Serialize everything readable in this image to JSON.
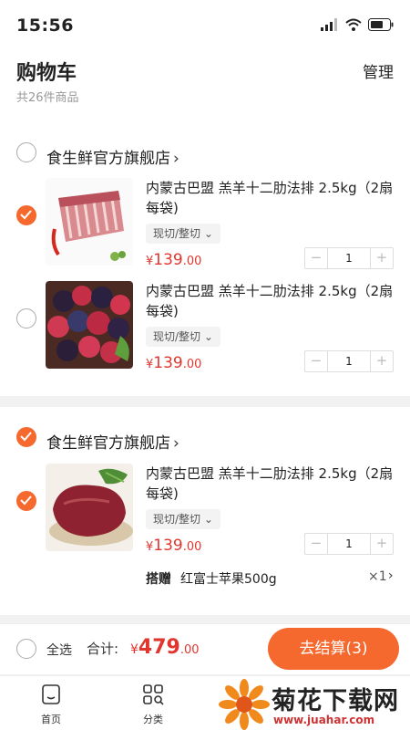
{
  "status": {
    "time": "15:56"
  },
  "header": {
    "title": "购物车",
    "count_text": "共26件商品",
    "manage_label": "管理"
  },
  "stores": [
    {
      "name": "食生鲜官方旗舰店",
      "checked": false,
      "products": [
        {
          "title": "内蒙古巴盟 羔羊十二肋法排 2.5kg（2扇每袋)",
          "spec": "现切/整切",
          "currency": "¥",
          "price_int": "139",
          "price_dec": ".00",
          "quantity": "1",
          "checked": true
        },
        {
          "title": "内蒙古巴盟 羔羊十二肋法排 2.5kg（2扇每袋)",
          "spec": "现切/整切",
          "currency": "¥",
          "price_int": "139",
          "price_dec": ".00",
          "quantity": "1",
          "checked": false
        }
      ]
    },
    {
      "name": "食生鲜官方旗舰店",
      "checked": true,
      "products": [
        {
          "title": "内蒙古巴盟 羔羊十二肋法排 2.5kg（2扇每袋)",
          "spec": "现切/整切",
          "currency": "¥",
          "price_int": "139",
          "price_dec": ".00",
          "quantity": "1",
          "checked": true
        }
      ],
      "gift": {
        "label": "搭赠",
        "name": "红富士苹果500g",
        "qty": "×1"
      }
    }
  ],
  "stepper": {
    "minus": "−",
    "plus": "+"
  },
  "footer": {
    "select_all": "全选",
    "total_label": "合计:",
    "total_currency": "¥",
    "total_int": "479",
    "total_dec": ".00",
    "checkout_label": "去结算(3)"
  },
  "tabs": [
    {
      "label": "首页",
      "icon": "home-icon"
    },
    {
      "label": "分类",
      "icon": "category-icon"
    }
  ],
  "watermark": {
    "text": "菊花下载网",
    "url": "www.juahar.com"
  },
  "colors": {
    "accent": "#f5692e",
    "price": "#e0362e"
  }
}
